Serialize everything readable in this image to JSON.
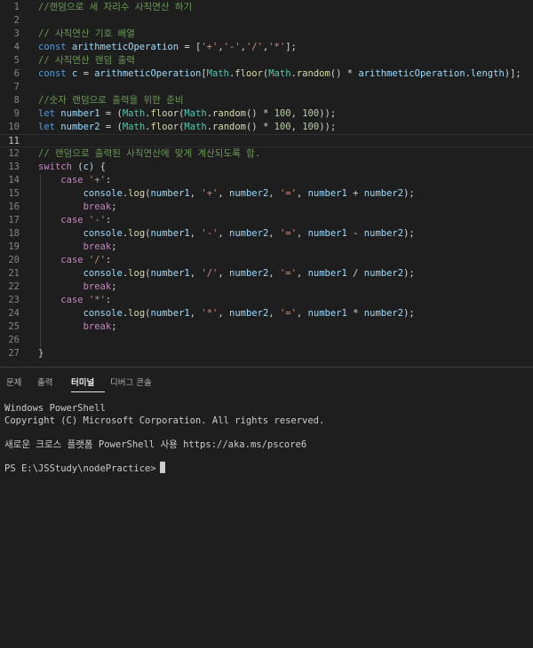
{
  "editor": {
    "current_line": 11,
    "lines": [
      {
        "n": "1",
        "tokens": [
          [
            "c",
            "//랜덤으로 세 자리수 사칙연산 하기"
          ]
        ]
      },
      {
        "n": "2",
        "tokens": []
      },
      {
        "n": "3",
        "tokens": [
          [
            "c",
            "// 사칙연산 기호 배열"
          ]
        ]
      },
      {
        "n": "4",
        "tokens": [
          [
            "k",
            "const"
          ],
          [
            "p",
            " "
          ],
          [
            "v",
            "arithmeticOperation"
          ],
          [
            "p",
            " = ["
          ],
          [
            "s",
            "'+'"
          ],
          [
            "p",
            ","
          ],
          [
            "s",
            "'-'"
          ],
          [
            "p",
            ","
          ],
          [
            "s",
            "'/'"
          ],
          [
            "p",
            ","
          ],
          [
            "s",
            "'*'"
          ],
          [
            "p",
            "];"
          ]
        ]
      },
      {
        "n": "5",
        "tokens": [
          [
            "c",
            "// 사칙연산 랜덤 출력"
          ]
        ]
      },
      {
        "n": "6",
        "tokens": [
          [
            "k",
            "const"
          ],
          [
            "p",
            " "
          ],
          [
            "v",
            "c"
          ],
          [
            "p",
            " = "
          ],
          [
            "v",
            "arithmeticOperation"
          ],
          [
            "p",
            "["
          ],
          [
            "cl",
            "Math"
          ],
          [
            "p",
            "."
          ],
          [
            "f",
            "floor"
          ],
          [
            "p",
            "("
          ],
          [
            "cl",
            "Math"
          ],
          [
            "p",
            "."
          ],
          [
            "f",
            "random"
          ],
          [
            "p",
            "() * "
          ],
          [
            "v",
            "arithmeticOperation"
          ],
          [
            "p",
            "."
          ],
          [
            "v",
            "length"
          ],
          [
            "p",
            ")];"
          ]
        ]
      },
      {
        "n": "7",
        "tokens": []
      },
      {
        "n": "8",
        "tokens": [
          [
            "c",
            "//숫자 랜덤으로 출력을 위한 준비"
          ]
        ]
      },
      {
        "n": "9",
        "tokens": [
          [
            "k",
            "let"
          ],
          [
            "p",
            " "
          ],
          [
            "v",
            "number1"
          ],
          [
            "p",
            " = ("
          ],
          [
            "cl",
            "Math"
          ],
          [
            "p",
            "."
          ],
          [
            "f",
            "floor"
          ],
          [
            "p",
            "("
          ],
          [
            "cl",
            "Math"
          ],
          [
            "p",
            "."
          ],
          [
            "f",
            "random"
          ],
          [
            "p",
            "() * "
          ],
          [
            "n",
            "100"
          ],
          [
            "p",
            ", "
          ],
          [
            "n",
            "100"
          ],
          [
            "p",
            "));"
          ]
        ]
      },
      {
        "n": "10",
        "tokens": [
          [
            "k",
            "let"
          ],
          [
            "p",
            " "
          ],
          [
            "v",
            "number2"
          ],
          [
            "p",
            " = ("
          ],
          [
            "cl",
            "Math"
          ],
          [
            "p",
            "."
          ],
          [
            "f",
            "floor"
          ],
          [
            "p",
            "("
          ],
          [
            "cl",
            "Math"
          ],
          [
            "p",
            "."
          ],
          [
            "f",
            "random"
          ],
          [
            "p",
            "() * "
          ],
          [
            "n",
            "100"
          ],
          [
            "p",
            ", "
          ],
          [
            "n",
            "100"
          ],
          [
            "p",
            "));"
          ]
        ]
      },
      {
        "n": "11",
        "tokens": []
      },
      {
        "n": "12",
        "tokens": [
          [
            "c",
            "// 랜덤으로 출력된 사칙연산에 맞게 계산되도록 함."
          ]
        ]
      },
      {
        "n": "13",
        "tokens": [
          [
            "x",
            "switch"
          ],
          [
            "p",
            " ("
          ],
          [
            "v",
            "c"
          ],
          [
            "p",
            ") {"
          ]
        ]
      },
      {
        "n": "14",
        "tokens": [
          [
            "p",
            "    "
          ],
          [
            "x",
            "case"
          ],
          [
            "p",
            " "
          ],
          [
            "s",
            "'+'"
          ],
          [
            "p",
            ":"
          ]
        ]
      },
      {
        "n": "15",
        "tokens": [
          [
            "p",
            "        "
          ],
          [
            "v",
            "console"
          ],
          [
            "p",
            "."
          ],
          [
            "f",
            "log"
          ],
          [
            "p",
            "("
          ],
          [
            "v",
            "number1"
          ],
          [
            "p",
            ", "
          ],
          [
            "s",
            "'+'"
          ],
          [
            "p",
            ", "
          ],
          [
            "v",
            "number2"
          ],
          [
            "p",
            ", "
          ],
          [
            "s",
            "'='"
          ],
          [
            "p",
            ", "
          ],
          [
            "v",
            "number1"
          ],
          [
            "p",
            " + "
          ],
          [
            "v",
            "number2"
          ],
          [
            "p",
            ");"
          ]
        ]
      },
      {
        "n": "16",
        "tokens": [
          [
            "p",
            "        "
          ],
          [
            "x",
            "break"
          ],
          [
            "p",
            ";"
          ]
        ]
      },
      {
        "n": "17",
        "tokens": [
          [
            "p",
            "    "
          ],
          [
            "x",
            "case"
          ],
          [
            "p",
            " "
          ],
          [
            "s",
            "'-'"
          ],
          [
            "p",
            ":"
          ]
        ]
      },
      {
        "n": "18",
        "tokens": [
          [
            "p",
            "        "
          ],
          [
            "v",
            "console"
          ],
          [
            "p",
            "."
          ],
          [
            "f",
            "log"
          ],
          [
            "p",
            "("
          ],
          [
            "v",
            "number1"
          ],
          [
            "p",
            ", "
          ],
          [
            "s",
            "'-'"
          ],
          [
            "p",
            ", "
          ],
          [
            "v",
            "number2"
          ],
          [
            "p",
            ", "
          ],
          [
            "s",
            "'='"
          ],
          [
            "p",
            ", "
          ],
          [
            "v",
            "number1"
          ],
          [
            "p",
            " - "
          ],
          [
            "v",
            "number2"
          ],
          [
            "p",
            ");"
          ]
        ]
      },
      {
        "n": "19",
        "tokens": [
          [
            "p",
            "        "
          ],
          [
            "x",
            "break"
          ],
          [
            "p",
            ";"
          ]
        ]
      },
      {
        "n": "20",
        "tokens": [
          [
            "p",
            "    "
          ],
          [
            "x",
            "case"
          ],
          [
            "p",
            " "
          ],
          [
            "s",
            "'/'"
          ],
          [
            "p",
            ":"
          ]
        ]
      },
      {
        "n": "21",
        "tokens": [
          [
            "p",
            "        "
          ],
          [
            "v",
            "console"
          ],
          [
            "p",
            "."
          ],
          [
            "f",
            "log"
          ],
          [
            "p",
            "("
          ],
          [
            "v",
            "number1"
          ],
          [
            "p",
            ", "
          ],
          [
            "s",
            "'/'"
          ],
          [
            "p",
            ", "
          ],
          [
            "v",
            "number2"
          ],
          [
            "p",
            ", "
          ],
          [
            "s",
            "'='"
          ],
          [
            "p",
            ", "
          ],
          [
            "v",
            "number1"
          ],
          [
            "p",
            " / "
          ],
          [
            "v",
            "number2"
          ],
          [
            "p",
            ");"
          ]
        ]
      },
      {
        "n": "22",
        "tokens": [
          [
            "p",
            "        "
          ],
          [
            "x",
            "break"
          ],
          [
            "p",
            ";"
          ]
        ]
      },
      {
        "n": "23",
        "tokens": [
          [
            "p",
            "    "
          ],
          [
            "x",
            "case"
          ],
          [
            "p",
            " "
          ],
          [
            "s",
            "'*'"
          ],
          [
            "p",
            ":"
          ]
        ]
      },
      {
        "n": "24",
        "tokens": [
          [
            "p",
            "        "
          ],
          [
            "v",
            "console"
          ],
          [
            "p",
            "."
          ],
          [
            "f",
            "log"
          ],
          [
            "p",
            "("
          ],
          [
            "v",
            "number1"
          ],
          [
            "p",
            ", "
          ],
          [
            "s",
            "'*'"
          ],
          [
            "p",
            ", "
          ],
          [
            "v",
            "number2"
          ],
          [
            "p",
            ", "
          ],
          [
            "s",
            "'='"
          ],
          [
            "p",
            ", "
          ],
          [
            "v",
            "number1"
          ],
          [
            "p",
            " * "
          ],
          [
            "v",
            "number2"
          ],
          [
            "p",
            ");"
          ]
        ]
      },
      {
        "n": "25",
        "tokens": [
          [
            "p",
            "        "
          ],
          [
            "x",
            "break"
          ],
          [
            "p",
            ";"
          ]
        ]
      },
      {
        "n": "26",
        "tokens": [
          [
            "p",
            "    "
          ]
        ]
      },
      {
        "n": "27",
        "tokens": [
          [
            "p",
            "}"
          ]
        ]
      }
    ]
  },
  "panel": {
    "tabs": [
      {
        "label": "문제"
      },
      {
        "label": "출력"
      },
      {
        "label": "터미널"
      },
      {
        "label": "디버그 콘솔"
      }
    ],
    "active_tab": "터미널",
    "terminal": {
      "line1": "Windows PowerShell",
      "line2": "Copyright (C) Microsoft Corporation. All rights reserved.",
      "line3": "새로운 크로스 플랫폼 PowerShell 사용 https://aka.ms/pscore6",
      "prompt": "PS E:\\JSStudy\\nodePractice>"
    }
  }
}
